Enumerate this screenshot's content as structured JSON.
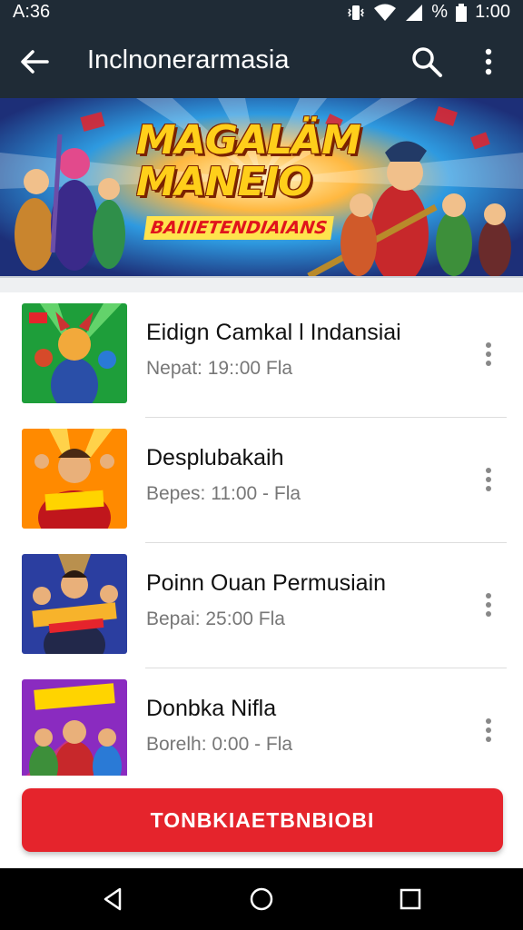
{
  "status_bar": {
    "left_time": "A:36",
    "battery_text": "%",
    "right_time": "1:00"
  },
  "app_bar": {
    "title": "Inclnonerarmasia",
    "back_icon": "arrow-left-icon",
    "search_icon": "search-icon",
    "more_icon": "more-vert-icon"
  },
  "banner": {
    "title_line1": "MAGALÄM",
    "title_line2": "MANEIO",
    "subtitle": "BAIIIETENDIAIANS"
  },
  "list": {
    "items": [
      {
        "title": "Eidign Camkal l Indansiai",
        "subtitle": "Nepat: 19::00  Fla",
        "thumb_colors": [
          "#1e9e3a",
          "#f2c14e"
        ]
      },
      {
        "title": "Desplubakaih",
        "subtitle": "Bepes: 11:00 - Fla",
        "thumb_colors": [
          "#ff8a00",
          "#c0161c"
        ]
      },
      {
        "title": "Poinn Ouan Permusiain",
        "subtitle": "Bepai: 25:00  Fla",
        "thumb_colors": [
          "#2b3ea0",
          "#f7b32b"
        ]
      },
      {
        "title": "Donbka Nifla",
        "subtitle": "Borelh: 0:00 - Fla",
        "thumb_colors": [
          "#8a2bc0",
          "#f03a5a"
        ]
      }
    ]
  },
  "cta": {
    "label": "TONBKIAETBNBIOBI"
  },
  "colors": {
    "app_bar": "#1f2b36",
    "accent": "#e5242c",
    "nav": "#000000"
  },
  "nav": {
    "back_icon": "nav-back-icon",
    "home_icon": "nav-home-icon",
    "recents_icon": "nav-recents-icon"
  }
}
